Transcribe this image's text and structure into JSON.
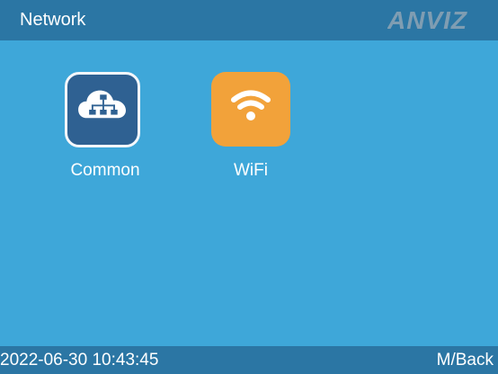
{
  "header": {
    "title": "Network",
    "logo_text": "ANVIZ"
  },
  "apps": [
    {
      "label": "Common",
      "icon": "cloud-network-icon",
      "accent": "#2f6192"
    },
    {
      "label": "WiFi",
      "icon": "wifi-icon",
      "accent": "#f2a23a"
    }
  ],
  "footer": {
    "datetime": "2022-06-30 10:43:45",
    "back_label": "M/Back"
  },
  "colors": {
    "background": "#3ea7d9",
    "bar": "#2b76a4",
    "text": "#ffffff"
  }
}
